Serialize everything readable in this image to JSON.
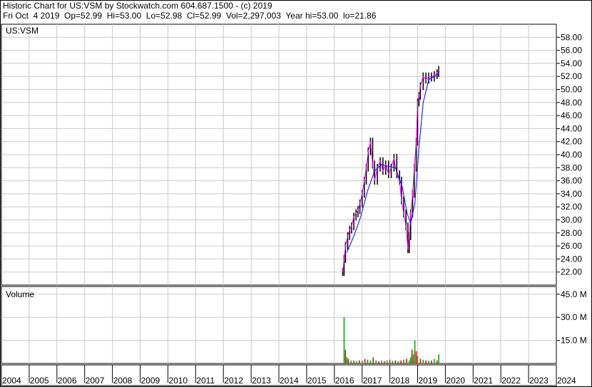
{
  "header": {
    "title": "Historic Chart for US:VSM by Stockwatch.com 604.687.1500 - (c) 2019",
    "quote": "Fri Oct  4 2019  Op=52.99  Hi=53.00  Lo=52.98  Cl=52.99  Vol=2,297,003  Year hi=53.00  lo=21.86"
  },
  "colors": {
    "grid": "#c8c8c8",
    "frame": "#000000",
    "price_bar": "#000000",
    "ma_fast": "#ff00ff",
    "ma_slow": "#0000ff",
    "volume_up": "#00a000",
    "volume_down": "#e00000"
  },
  "chart_data": [
    {
      "type": "line",
      "title": "US:VSM",
      "ylim": [
        20,
        60
      ],
      "y_ticks": [
        "58.00",
        "56.00",
        "54.00",
        "52.00",
        "50.00",
        "48.00",
        "46.00",
        "44.00",
        "42.00",
        "40.00",
        "38.00",
        "36.00",
        "34.00",
        "32.00",
        "30.00",
        "28.00",
        "26.00",
        "24.00",
        "22.00"
      ],
      "x_ticks": [
        "2004",
        "2005",
        "2006",
        "2007",
        "2008",
        "2009",
        "2010",
        "2011",
        "2012",
        "2013",
        "2014",
        "2015",
        "2016",
        "2017",
        "2018",
        "2019",
        "2020",
        "2021",
        "2022",
        "2023",
        "2024"
      ],
      "grid": true,
      "series": [
        {
          "x": [
            2016.3,
            2016.35,
            2016.4,
            2016.48,
            2016.55,
            2016.62,
            2016.7,
            2016.78,
            2016.85,
            2016.92,
            2017.0,
            2017.08,
            2017.15,
            2017.22,
            2017.3,
            2017.38,
            2017.45,
            2017.55,
            2017.65,
            2017.75,
            2017.85,
            2017.95,
            2018.05,
            2018.15,
            2018.25,
            2018.35,
            2018.42,
            2018.5,
            2018.58,
            2018.65,
            2018.7,
            2018.75,
            2018.82,
            2018.88,
            2018.95,
            2019.0,
            2019.05,
            2019.1,
            2019.2,
            2019.3,
            2019.4,
            2019.5,
            2019.6,
            2019.7,
            2019.76
          ],
          "values": [
            22.0,
            24.0,
            26.0,
            27.5,
            28.5,
            29.0,
            30.5,
            31.0,
            31.5,
            32.5,
            34.0,
            36.0,
            38.0,
            40.5,
            42.0,
            38.5,
            36.0,
            38.0,
            39.0,
            37.5,
            38.5,
            37.0,
            38.0,
            39.5,
            37.0,
            36.0,
            33.0,
            31.0,
            29.0,
            25.5,
            27.5,
            31.0,
            34.0,
            38.0,
            42.0,
            48.0,
            49.0,
            50.5,
            52.0,
            51.5,
            52.0,
            51.8,
            52.2,
            52.5,
            53.0
          ]
        },
        {
          "x": [
            2016.45,
            2016.7,
            2016.95,
            2017.2,
            2017.45,
            2017.7,
            2017.95,
            2018.2,
            2018.45,
            2018.62,
            2018.75,
            2018.9,
            2019.05,
            2019.2,
            2019.4,
            2019.6,
            2019.76
          ],
          "values": [
            25.0,
            27.5,
            30.5,
            34.5,
            37.5,
            38.5,
            38.2,
            38.0,
            35.0,
            31.0,
            29.5,
            32.5,
            41.0,
            48.0,
            51.5,
            52.0,
            52.4
          ]
        }
      ]
    },
    {
      "type": "bar",
      "title": "Volume",
      "ylim": [
        0,
        50
      ],
      "y_ticks": [
        "45.0 M",
        "30.0 M",
        "15.0 M"
      ],
      "series": [
        {
          "x": [
            2016.35,
            2016.4,
            2016.45,
            2016.5,
            2016.6,
            2016.7,
            2016.8,
            2016.9,
            2017.0,
            2017.1,
            2017.2,
            2017.3,
            2017.4,
            2017.5,
            2017.6,
            2017.7,
            2017.8,
            2017.9,
            2018.0,
            2018.1,
            2018.2,
            2018.3,
            2018.4,
            2018.5,
            2018.6,
            2018.7,
            2018.75,
            2018.8,
            2018.85,
            2018.9,
            2018.95,
            2019.0,
            2019.1,
            2019.2,
            2019.3,
            2019.4,
            2019.5,
            2019.6,
            2019.7,
            2019.76
          ],
          "values": [
            30,
            9,
            4,
            3,
            2,
            2,
            1.5,
            2,
            1.8,
            3,
            2.5,
            2,
            4,
            2,
            1.5,
            2,
            1.5,
            2,
            2.5,
            1.8,
            2,
            1.5,
            2,
            2.5,
            3,
            2,
            4,
            9,
            6,
            15,
            8,
            5,
            3,
            2.5,
            2,
            1.8,
            2,
            3,
            2,
            6
          ],
          "up": [
            true,
            false,
            true,
            false,
            true,
            false,
            true,
            false,
            true,
            false,
            true,
            true,
            false,
            true,
            false,
            true,
            false,
            true,
            false,
            true,
            false,
            true,
            false,
            true,
            false,
            true,
            true,
            false,
            true,
            true,
            false,
            true,
            false,
            true,
            false,
            true,
            false,
            true,
            false,
            true
          ]
        }
      ]
    }
  ]
}
